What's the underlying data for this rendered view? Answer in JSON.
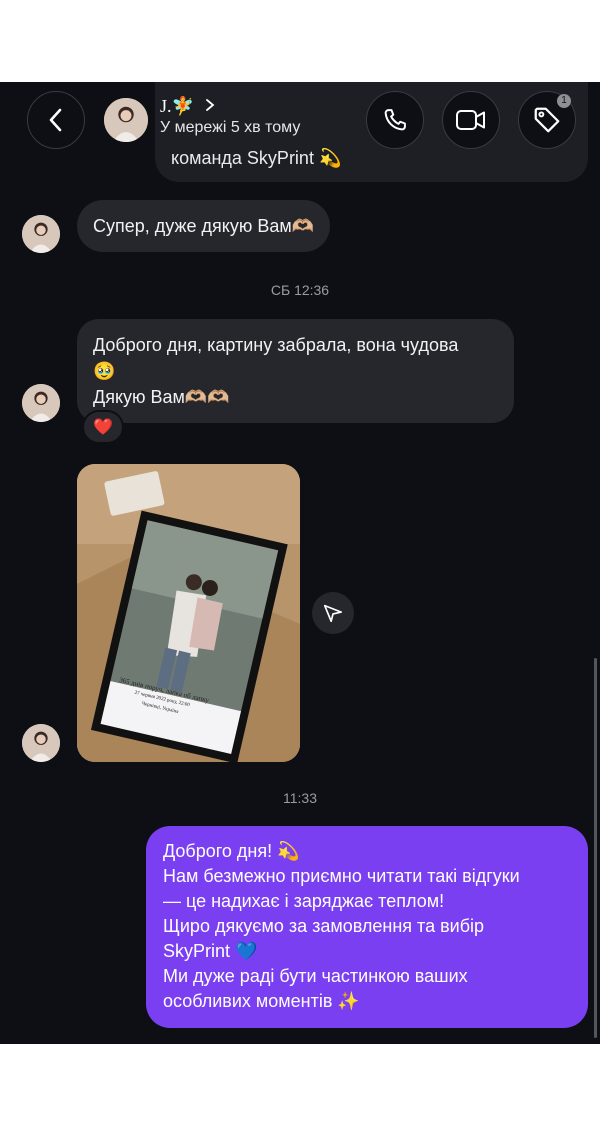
{
  "header": {
    "contact_name": "Ј.🧚",
    "status": "У мережі 5 хв тому",
    "banner_text": "команда SkyPrint 💫",
    "tag_badge": "1"
  },
  "messages": {
    "msg1": "Супер, дуже дякую Вам🫶🏼",
    "time1": "СБ 12:36",
    "msg2_line1": "Доброго дня, картину забрала, вона чудова",
    "msg2_line2": "🥹",
    "msg2_line3": "Дякую Вам🫶🏼🫶🏼",
    "reaction": "❤️",
    "photo_caption_line1": "365 днів поруч, лапка об лапку",
    "photo_caption_line2": "27 червня 2022 року, 22:00",
    "photo_caption_line3": "Чернівці, Україна",
    "time2": "11:33",
    "reply_lines": [
      "Доброго дня! 💫",
      "Нам безмежно приємно читати такі відгуки",
      "— це надихає і заряджає теплом!",
      "Щиро дякуємо за замовлення та вибір",
      "SkyPrint 💙",
      "Ми дуже раді бути частинкою ваших",
      "особливих моментів ✨"
    ]
  },
  "colors": {
    "background": "#0e0f14",
    "incoming_bubble": "#26272d",
    "outgoing_bubble": "#7b3ff2"
  },
  "icons": [
    "back-icon",
    "phone-icon",
    "video-icon",
    "tag-icon",
    "share-icon",
    "chevron-right-icon"
  ]
}
